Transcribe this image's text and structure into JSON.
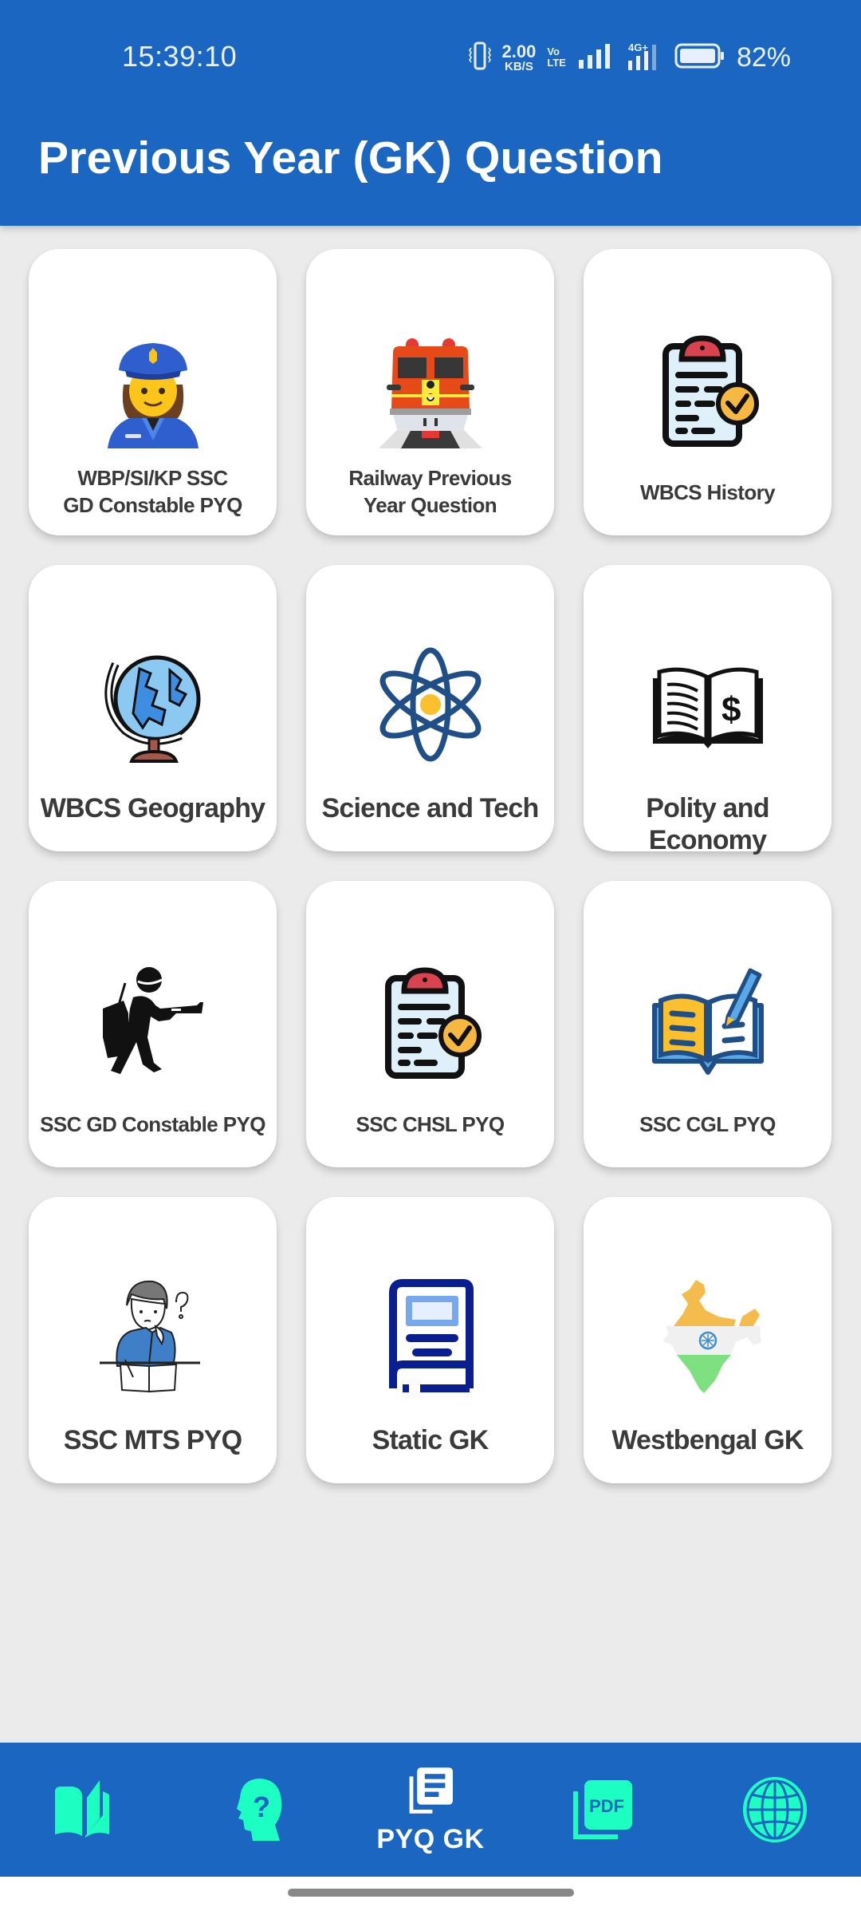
{
  "status_bar": {
    "time": "15:39:10",
    "network_speed_value": "2.00",
    "network_speed_unit": "KB/S",
    "volte_top": "Vo",
    "volte_bottom": "LTE",
    "network_type": "4G+",
    "battery_percent": "82%",
    "battery_level": 0.82
  },
  "header": {
    "title": "Previous Year (GK) Question"
  },
  "categories": [
    {
      "label_line1": "WBP/SI/KP SSC",
      "label_line2": "GD Constable  PYQ",
      "icon": "police-officer-icon"
    },
    {
      "label_line1": "Railway Previous",
      "label_line2": "Year Question",
      "icon": "train-icon"
    },
    {
      "label_line1": "WBCS History",
      "icon": "clipboard-check-icon"
    },
    {
      "label_line1": "WBCS Geography",
      "icon": "globe-icon"
    },
    {
      "label_line1": "Science and Tech",
      "icon": "atom-icon"
    },
    {
      "label_line1": "Polity and Economy",
      "icon": "book-dollar-icon"
    },
    {
      "label_line1": "SSC GD Constable PYQ",
      "icon": "soldier-icon"
    },
    {
      "label_line1": "SSC CHSL PYQ",
      "icon": "clipboard-check-icon"
    },
    {
      "label_line1": "SSC CGL PYQ",
      "icon": "book-pencil-icon"
    },
    {
      "label_line1": "SSC MTS PYQ",
      "icon": "student-thinking-icon"
    },
    {
      "label_line1": "Static GK",
      "icon": "book-icon"
    },
    {
      "label_line1": "Westbengal GK",
      "icon": "india-map-icon"
    }
  ],
  "bottom_nav": {
    "items": [
      {
        "icon": "open-book-icon",
        "label": "",
        "active": false
      },
      {
        "icon": "head-question-icon",
        "label": "",
        "active": false
      },
      {
        "icon": "library-books-icon",
        "label": "PYQ GK",
        "active": true
      },
      {
        "icon": "pdf-icon",
        "label": "",
        "active": false
      },
      {
        "icon": "globe-icon",
        "label": "",
        "active": false
      }
    ]
  },
  "colors": {
    "primary": "#1a66c0",
    "accent": "#1dffc2",
    "background": "#ebebeb",
    "card": "#ffffff",
    "label_text": "#3a3a3a"
  }
}
